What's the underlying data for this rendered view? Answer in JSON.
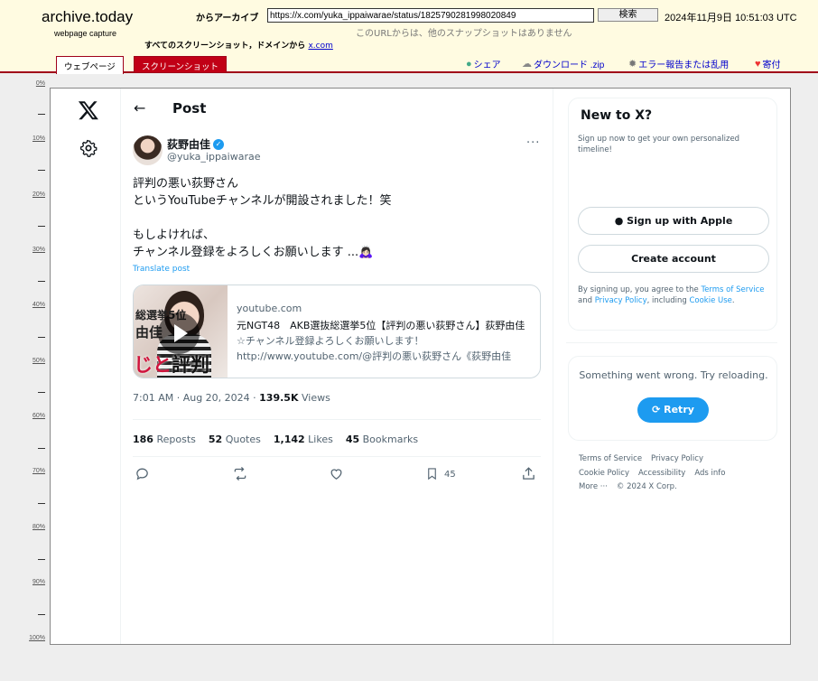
{
  "archive": {
    "logo": "archive.today",
    "logo_sub": "webpage capture",
    "archive_label": "からアーカイブ",
    "url_value": "https://x.com/yuka_ippaiwarae/status/1825790281998020849",
    "search_label": "検索",
    "timestamp": "2024年11月9日 10:51:03 UTC",
    "no_snapshots": "このURLからは、他のスナップショットはありません",
    "all_screenshots": "すべてのスクリーンショット，ドメインから",
    "domain_link": "x.com",
    "tab_webpage": "ウェブページ",
    "tab_screenshot": "スクリーンショット",
    "share": "シェア",
    "download": "ダウンロード .zip",
    "report": "エラー報告または乱用",
    "donate": "寄付",
    "ruler": [
      "0%",
      "10%",
      "20%",
      "30%",
      "40%",
      "50%",
      "60%",
      "70%",
      "80%",
      "90%",
      "100%"
    ]
  },
  "x": {
    "header_title": "Post",
    "display_name": "荻野由佳",
    "handle": "@yuka_ippaiwarae",
    "more": "···",
    "tweet_text": "評判の悪い荻野さん\nというYouTubeチャンネルが開設されました！笑\n\nもしよければ、\nチャンネル登録をよろしくお願いします ...🙇🏻‍♀️",
    "translate": "Translate post",
    "card": {
      "domain": "youtube.com",
      "title": "元NGT48　AKB選抜総選挙5位【評判の悪い荻野さん】荻野由佳",
      "line2": "☆チャンネル登録よろしくお願いします！",
      "line3": "http://www.youtube.com/@評判の悪い荻野さん《荻野由佳",
      "thumb_text1": "総選挙5位",
      "thumb_text2a": "由佳",
      "thumb_text3": "じと",
      "thumb_text4": "評判"
    },
    "time": "7:01 AM · Aug 20, 2024 · ",
    "views_count": "139.5K",
    "views_label": " Views",
    "stats": {
      "reposts_n": "186",
      "reposts_l": "Reposts",
      "quotes_n": "52",
      "quotes_l": "Quotes",
      "likes_n": "1,142",
      "likes_l": "Likes",
      "bookmarks_n": "45",
      "bookmarks_l": "Bookmarks"
    },
    "bookmark_count": "45",
    "sidebar": {
      "new_title": "New to X?",
      "new_desc": "Sign up now to get your own personalized timeline!",
      "apple": "Sign up with Apple",
      "create": "Create account",
      "terms_pre": "By signing up, you agree to the ",
      "terms_tos": "Terms of Service",
      "terms_and": " and ",
      "terms_pp": "Privacy Policy",
      "terms_inc": ", including ",
      "terms_cookie": "Cookie Use",
      "terms_end": ".",
      "error_msg": "Something went wrong. Try reloading.",
      "retry": "Retry",
      "footer": [
        "Terms of Service",
        "Privacy Policy",
        "Cookie Policy",
        "Accessibility",
        "Ads info",
        "More ···",
        "© 2024 X Corp."
      ]
    }
  },
  "colors": {
    "accent": "#1d9bf0",
    "archive_red": "#c10016",
    "archive_bg": "#fffbe1"
  }
}
